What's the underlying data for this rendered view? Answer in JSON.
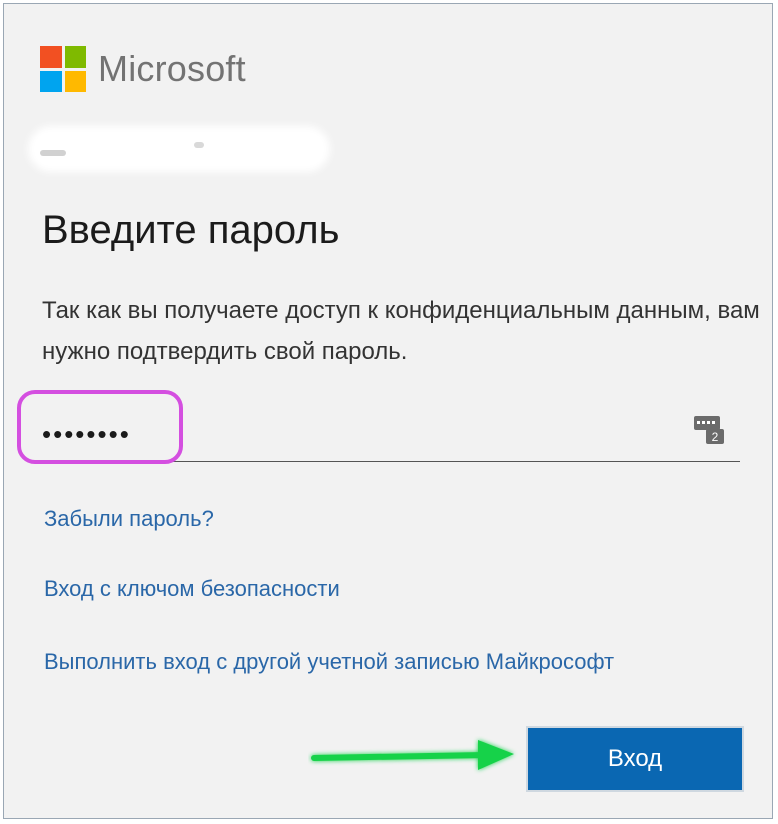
{
  "brand": {
    "name": "Microsoft",
    "colors": [
      "#f25022",
      "#7fba00",
      "#00a4ef",
      "#ffb900"
    ],
    "text_color": "#737373"
  },
  "page": {
    "title": "Введите пароль",
    "description": "Так как вы получаете доступ к конфиденциальным данным, вам нужно подтвердить свой пароль."
  },
  "password": {
    "value": "••••••••",
    "icon": "password-key-icon"
  },
  "links": {
    "forgot": "Забыли пароль?",
    "security_key": "Вход с ключом безопасности",
    "other_account": "Выполнить вход с другой учетной записью Майкрософт"
  },
  "actions": {
    "signin_label": "Вход",
    "accent_color": "#0a67b2"
  },
  "annotations": {
    "highlight_color": "#d44fe0",
    "arrow_color": "#19d24a"
  }
}
